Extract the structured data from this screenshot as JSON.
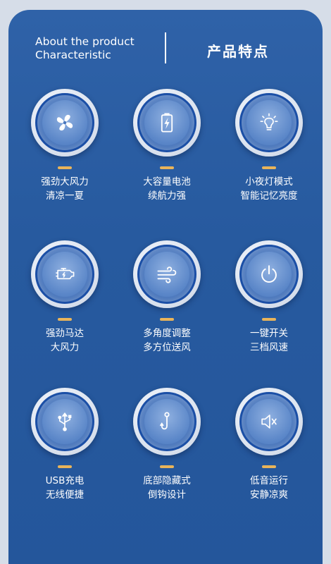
{
  "header": {
    "en_line1": "About the product",
    "en_line2": "Characteristic",
    "zh_title": "产品特点"
  },
  "features": [
    {
      "line1": "强劲大风力",
      "line2": "清凉一夏",
      "icon": "fan-icon"
    },
    {
      "line1": "大容量电池",
      "line2": "续航力强",
      "icon": "battery-icon"
    },
    {
      "line1": "小夜灯模式",
      "line2": "智能记忆亮度",
      "icon": "lightbulb-icon"
    },
    {
      "line1": "强劲马达",
      "line2": "大风力",
      "icon": "motor-icon"
    },
    {
      "line1": "多角度调整",
      "line2": "多方位送风",
      "icon": "wind-icon"
    },
    {
      "line1": "一键开关",
      "line2": "三档风速",
      "icon": "power-icon"
    },
    {
      "line1": "USB充电",
      "line2": "无线便捷",
      "icon": "usb-icon"
    },
    {
      "line1": "底部隐藏式",
      "line2": "倒钩设计",
      "icon": "hook-icon"
    },
    {
      "line1": "低音运行",
      "line2": "安静凉爽",
      "icon": "mute-speaker-icon"
    }
  ],
  "colors": {
    "panel": "#2a5da3",
    "accent_dash": "#e9b45a",
    "ring": "#1b4fa6"
  }
}
